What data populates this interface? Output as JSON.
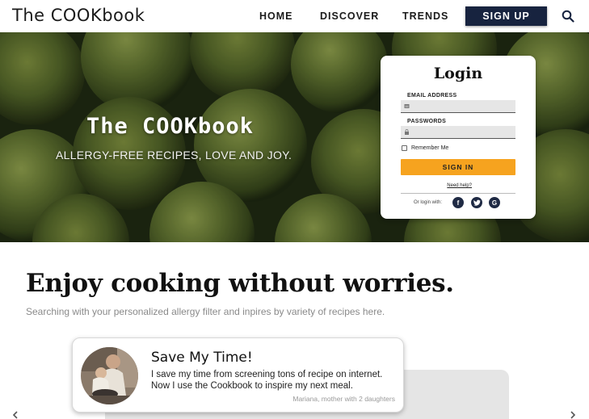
{
  "nav": {
    "logo": "The COOKbook",
    "links": [
      "HOME",
      "DISCOVER",
      "TRENDS"
    ],
    "signup_label": "SIGN UP",
    "search_icon": "search-icon"
  },
  "hero": {
    "title": "The COOKbook",
    "subtitle": "ALLERGY-FREE RECIPES, LOVE AND JOY."
  },
  "login": {
    "title": "Login",
    "email_label": "EMAIL ADDRESS",
    "email_value": "",
    "password_label": "PASSWORDS",
    "password_value": "",
    "remember_label": "Remember Me",
    "remember_checked": false,
    "signin_label": "SIGN IN",
    "help_link": "Need help?",
    "social_prompt": "Or login with:",
    "social": [
      {
        "icon": "facebook-icon",
        "glyph": "f"
      },
      {
        "icon": "twitter-icon",
        "glyph": "t"
      },
      {
        "icon": "google-icon",
        "glyph": "G"
      }
    ]
  },
  "main": {
    "headline": "Enjoy cooking without worries.",
    "subline": "Searching with your personalized allergy filter and inpires by variety of recipes here."
  },
  "testimonial": {
    "title": "Save My Time!",
    "body": "I save my time from screening tons of recipe on internet. Now I use the Cookbook to inspire my next meal.",
    "author": "Mariana, mother with 2 daughters"
  },
  "colors": {
    "navy": "#17233f",
    "accent_orange": "#f6a31f",
    "hero_green": "#4c5f2b"
  }
}
